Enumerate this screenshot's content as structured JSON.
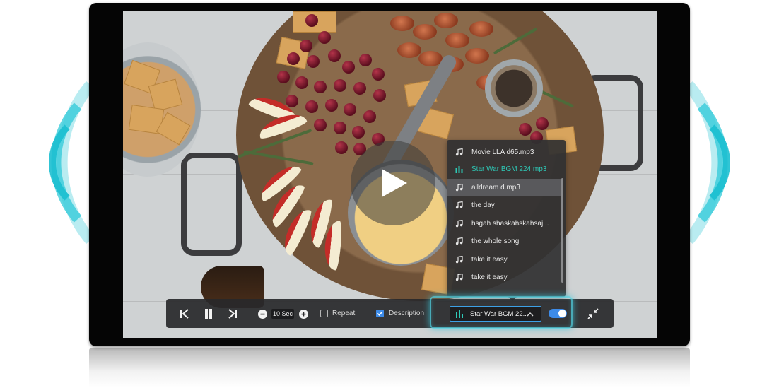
{
  "player": {
    "step_value": "10 Sec",
    "repeat": {
      "label": "Repeat",
      "checked": false
    },
    "description": {
      "label": "Description",
      "checked": true
    },
    "current_track": "Star War BGM 22...",
    "toggle_on": true,
    "accent_color": "#3d8be8",
    "active_track_color": "#2ec7b5"
  },
  "playlist": {
    "items": [
      {
        "label": "Movie LLA d65.mp3",
        "icon": "music-note-icon",
        "state": "normal"
      },
      {
        "label": "Star War BGM 224.mp3",
        "icon": "equalizer-icon",
        "state": "playing"
      },
      {
        "label": "alldream d.mp3",
        "icon": "music-note-icon",
        "state": "hover"
      },
      {
        "label": "the day",
        "icon": "music-note-icon",
        "state": "normal"
      },
      {
        "label": "hsgah shaskahskahsaj...",
        "icon": "music-note-icon",
        "state": "normal"
      },
      {
        "label": "the whole song",
        "icon": "music-note-icon",
        "state": "normal"
      },
      {
        "label": "take it easy",
        "icon": "music-note-icon",
        "state": "normal"
      },
      {
        "label": "take it easy",
        "icon": "music-note-icon",
        "state": "normal"
      }
    ]
  },
  "icons": {
    "play": "play-icon",
    "previous": "skip-previous-icon",
    "pause": "pause-icon",
    "next": "skip-next-icon",
    "decrease": "minus-circle-icon",
    "increase": "plus-circle-icon",
    "collapse": "minimize-icon"
  }
}
